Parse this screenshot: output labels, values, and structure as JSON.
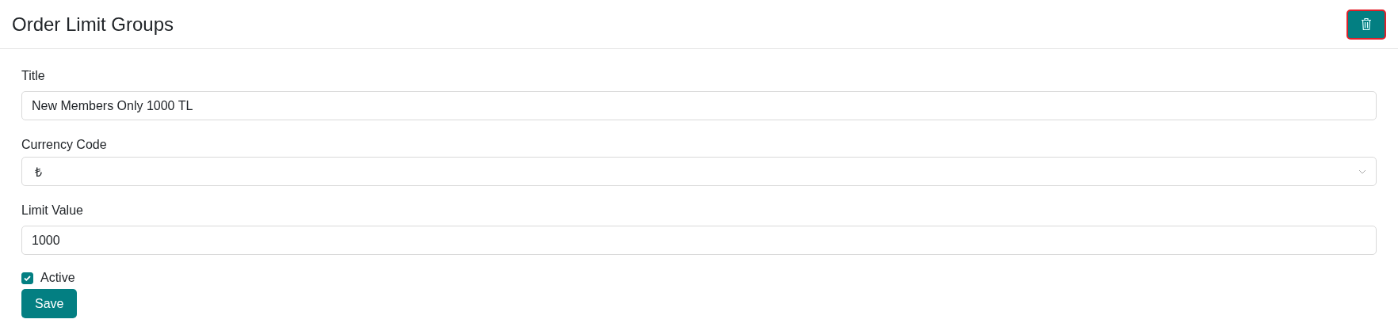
{
  "header": {
    "title": "Order Limit Groups",
    "delete_button": {
      "focused": true
    }
  },
  "fields": [
    {
      "kind": "text",
      "label": "Title",
      "value": "New Members Only 1000 TL"
    },
    {
      "kind": "select",
      "label": "Currency Code",
      "value": "₺"
    },
    {
      "kind": "text",
      "label": "Limit Value",
      "value": "1000"
    }
  ],
  "active": {
    "label": "Active",
    "checked": true
  },
  "save_button": {
    "label": "Save"
  }
}
